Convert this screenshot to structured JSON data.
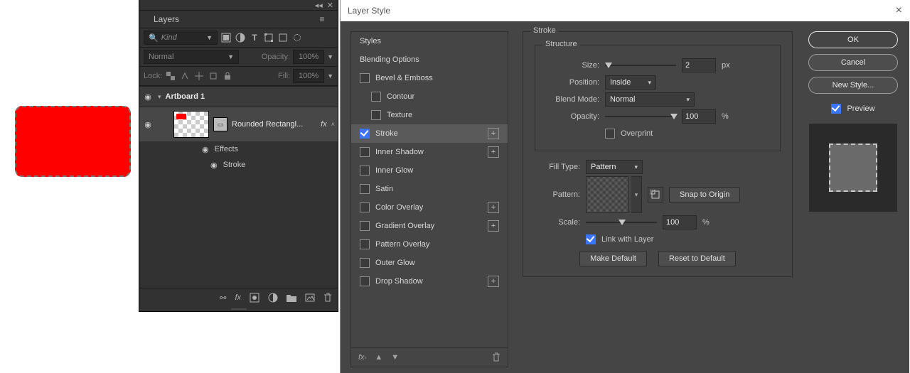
{
  "canvas": {
    "fill": "#ff0000"
  },
  "layers_panel": {
    "title": "Layers",
    "kind_placeholder": "Kind",
    "blend_mode": "Normal",
    "opacity_label": "Opacity:",
    "opacity_value": "100%",
    "lock_label": "Lock:",
    "fill_label": "Fill:",
    "fill_value": "100%",
    "tree": {
      "artboard": "Artboard 1",
      "layer_name": "Rounded Rectangl...",
      "effects_label": "Effects",
      "stroke_label": "Stroke",
      "fx_label": "fx"
    }
  },
  "dialog": {
    "title": "Layer Style",
    "styles_list": [
      {
        "label": "Styles",
        "type": "header"
      },
      {
        "label": "Blending Options",
        "type": "header"
      },
      {
        "label": "Bevel & Emboss",
        "type": "check"
      },
      {
        "label": "Contour",
        "type": "child"
      },
      {
        "label": "Texture",
        "type": "child"
      },
      {
        "label": "Stroke",
        "type": "check",
        "checked": true,
        "selected": true,
        "plus": true
      },
      {
        "label": "Inner Shadow",
        "type": "check",
        "plus": true
      },
      {
        "label": "Inner Glow",
        "type": "check"
      },
      {
        "label": "Satin",
        "type": "check"
      },
      {
        "label": "Color Overlay",
        "type": "check",
        "plus": true
      },
      {
        "label": "Gradient Overlay",
        "type": "check",
        "plus": true
      },
      {
        "label": "Pattern Overlay",
        "type": "check"
      },
      {
        "label": "Outer Glow",
        "type": "check"
      },
      {
        "label": "Drop Shadow",
        "type": "check",
        "plus": true
      }
    ],
    "stroke": {
      "group_title": "Stroke",
      "structure_title": "Structure",
      "size_label": "Size:",
      "size_value": "2",
      "size_unit": "px",
      "position_label": "Position:",
      "position_value": "Inside",
      "blend_label": "Blend Mode:",
      "blend_value": "Normal",
      "opacity_label": "Opacity:",
      "opacity_value": "100",
      "opacity_unit": "%",
      "overprint_label": "Overprint",
      "filltype_label": "Fill Type:",
      "filltype_value": "Pattern",
      "pattern_label": "Pattern:",
      "snap_label": "Snap to Origin",
      "scale_label": "Scale:",
      "scale_value": "100",
      "scale_unit": "%",
      "link_label": "Link with Layer",
      "make_default": "Make Default",
      "reset_default": "Reset to Default"
    },
    "buttons": {
      "ok": "OK",
      "cancel": "Cancel",
      "new_style": "New Style...",
      "preview": "Preview"
    }
  }
}
